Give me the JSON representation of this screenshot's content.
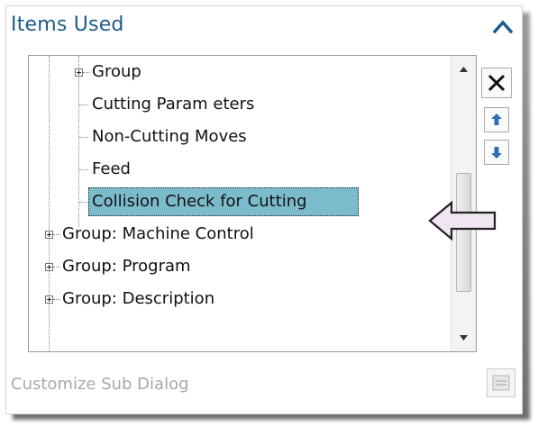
{
  "panel": {
    "title": "Items Used",
    "collapse_icon": "chevron-up-icon"
  },
  "tree": {
    "items": [
      {
        "label": "Group",
        "level": 1,
        "expandable": true,
        "selected": false
      },
      {
        "label": "Cutting Param eters",
        "level": 1,
        "expandable": false,
        "selected": false
      },
      {
        "label": "Non-Cutting Moves",
        "level": 1,
        "expandable": false,
        "selected": false
      },
      {
        "label": "Feed",
        "level": 1,
        "expandable": false,
        "selected": false
      },
      {
        "label": "Collision Check for Cutting",
        "level": 1,
        "expandable": false,
        "selected": true
      },
      {
        "label": "Group: Machine Control",
        "level": 0,
        "expandable": true,
        "selected": false
      },
      {
        "label": "Group: Program",
        "level": 0,
        "expandable": true,
        "selected": false
      },
      {
        "label": "Group: Description",
        "level": 0,
        "expandable": true,
        "selected": false
      }
    ]
  },
  "side_buttons": {
    "remove_icon": "close-icon",
    "move_up_icon": "arrow-up-icon",
    "move_down_icon": "arrow-down-icon"
  },
  "footer": {
    "customize_label": "Customize Sub Dialog",
    "customize_icon": "sub-dialog-icon"
  },
  "colors": {
    "title": "#1c5c8a",
    "selection": "#7bbbcc",
    "pointer_arrow": "#f0e6f2"
  }
}
